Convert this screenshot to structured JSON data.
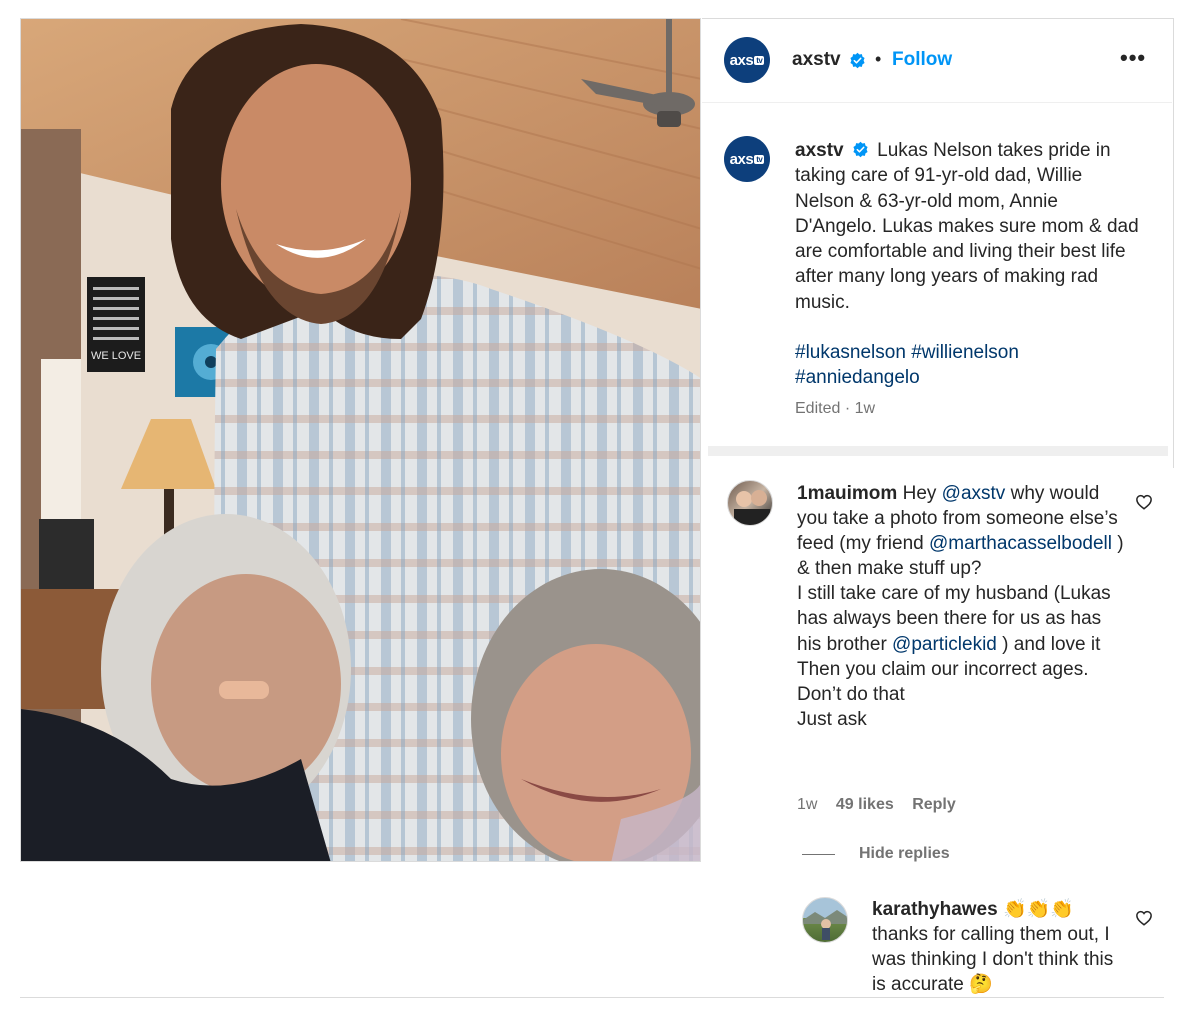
{
  "post": {
    "account": {
      "username": "axstv",
      "avatar_text": "axs",
      "avatar_badge": "tv",
      "follow_label": "Follow",
      "separator": "•",
      "more_label": "•••"
    },
    "caption": {
      "username": "axstv",
      "text": "Lukas Nelson takes pride in taking care of 91-yr-old dad, Willie Nelson & 63-yr-old mom, Annie D'Angelo. Lukas makes sure mom & dad are comfortable and living their best life after many long years of making rad music.",
      "hashtags": [
        "#lukasnelson",
        "#willienelson",
        "#anniedangelo"
      ],
      "edited": "Edited · 1w"
    },
    "photo": {
      "poster_text": "WE LOVE"
    }
  },
  "comments": [
    {
      "username": "1mauimom",
      "segments": [
        {
          "text": "Hey ",
          "mention": false
        },
        {
          "text": "@axstv",
          "mention": true
        },
        {
          "text": " why would you take a photo from someone else’s feed (my friend ",
          "mention": false
        },
        {
          "text": "@marthacasselbodell",
          "mention": true
        },
        {
          "text": " ) & then make stuff up?",
          "mention": false
        }
      ],
      "line2_segments": [
        {
          "text": "I still take care of my husband (Lukas has always been there for us as has his brother ",
          "mention": false
        },
        {
          "text": "@particlekid",
          "mention": true
        },
        {
          "text": " ) and love it",
          "mention": false
        }
      ],
      "line3": "Then you claim our incorrect ages.",
      "line4": "Don’t do that",
      "line5": "Just ask",
      "time": "1w",
      "likes": "49 likes",
      "reply_label": "Reply",
      "hide_replies_label": "Hide replies"
    },
    {
      "username": "karathyhawes",
      "username_emoji": "👏👏👏",
      "text": "thanks for calling them out, I was thinking I don't think this is accurate",
      "text_emoji": "🤔"
    }
  ],
  "colors": {
    "link_blue": "#0095f6",
    "mention_blue": "#00376b",
    "muted_gray": "#737373",
    "brand_navy": "#0d3f7c"
  },
  "icons": [
    "verified-badge-icon",
    "heart-icon",
    "more-options-icon"
  ]
}
